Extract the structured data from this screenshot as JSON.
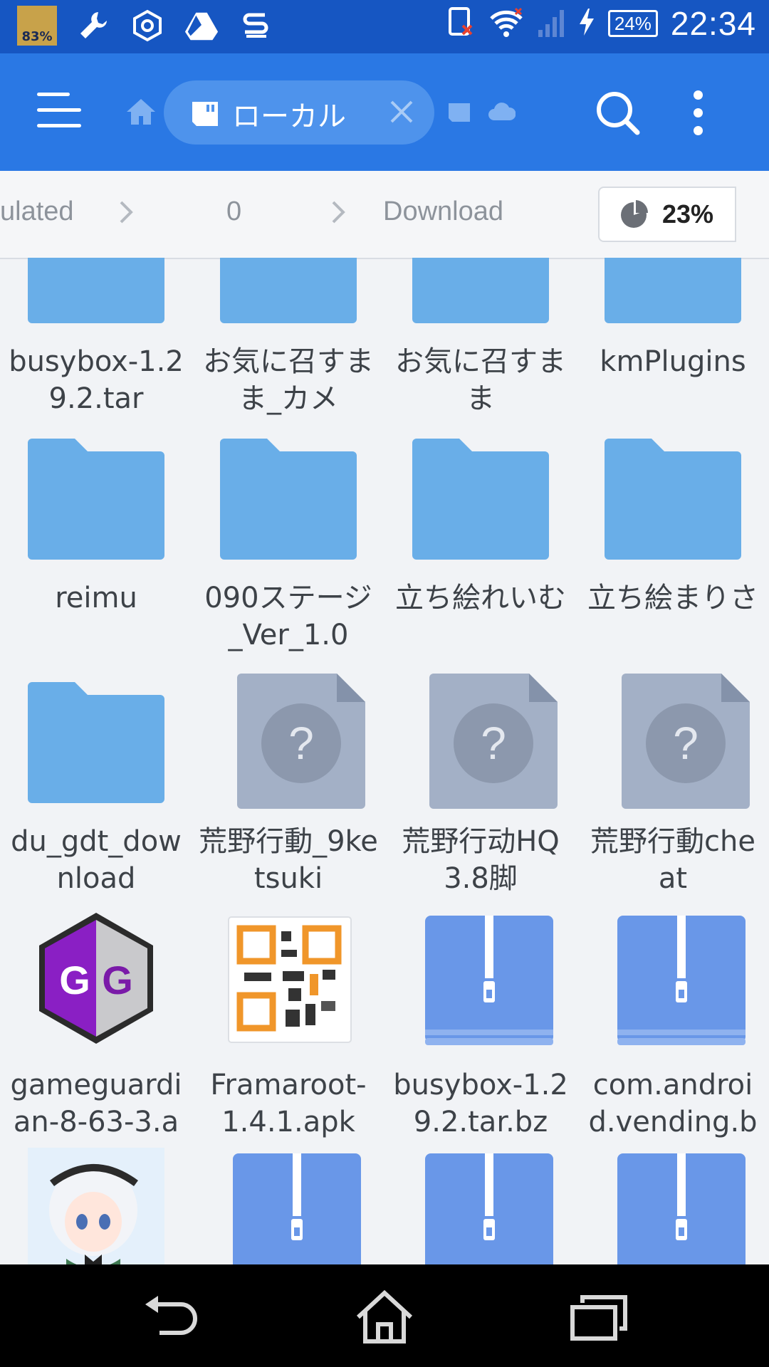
{
  "status_bar": {
    "app_badge": "83%",
    "battery": "24%",
    "time": "22:34",
    "icons": [
      "app-badge-icon",
      "wrench-icon",
      "hexagon-icon",
      "drive-icon",
      "s-logo-icon",
      "sim-error-icon",
      "wifi-icon",
      "signal-icon",
      "charging-icon",
      "battery-icon"
    ]
  },
  "toolbar": {
    "active_tab": "ローカル",
    "icons": [
      "menu-icon",
      "home-icon",
      "sd-card-icon",
      "close-icon",
      "network-storage-icon",
      "cloud-icon",
      "search-icon",
      "more-vert-icon"
    ]
  },
  "breadcrumb": {
    "items": [
      "ulated",
      "0",
      "Download"
    ],
    "storage_percent": "23%"
  },
  "files": [
    {
      "name": "busybox-1.29.2.tar",
      "type": "folder"
    },
    {
      "name": "お気に召すまま_カメ",
      "type": "folder"
    },
    {
      "name": "お気に召すまま",
      "type": "folder"
    },
    {
      "name": "kmPlugins",
      "type": "folder"
    },
    {
      "name": "reimu",
      "type": "folder"
    },
    {
      "name": "090ステージ_Ver_1.0",
      "type": "folder"
    },
    {
      "name": "立ち絵れいむ",
      "type": "folder"
    },
    {
      "name": "立ち絵まりさ",
      "type": "folder"
    },
    {
      "name": "du_gdt_download",
      "type": "folder"
    },
    {
      "name": "荒野行動_9ketsuki",
      "type": "unknown"
    },
    {
      "name": "荒野行动HQ3.8脚",
      "type": "unknown"
    },
    {
      "name": "荒野行動cheat",
      "type": "unknown"
    },
    {
      "name": "gameguardian-8-63-3.a",
      "type": "app"
    },
    {
      "name": "Framaroot-1.4.1.apk",
      "type": "qr"
    },
    {
      "name": "busybox-1.29.2.tar.bz",
      "type": "zip"
    },
    {
      "name": "com.android.vending.b",
      "type": "zip"
    },
    {
      "name": "",
      "type": "image"
    },
    {
      "name": "",
      "type": "zip"
    },
    {
      "name": "",
      "type": "zip"
    },
    {
      "name": "",
      "type": "zip"
    }
  ],
  "colors": {
    "status_bar": "#1656c2",
    "toolbar": "#2a78e4",
    "folder": "#69aee8",
    "zip": "#6997e8",
    "unknown": "#a3b0c6"
  },
  "nav_bar": {
    "icons": [
      "back-icon",
      "home-nav-icon",
      "recents-icon"
    ]
  }
}
